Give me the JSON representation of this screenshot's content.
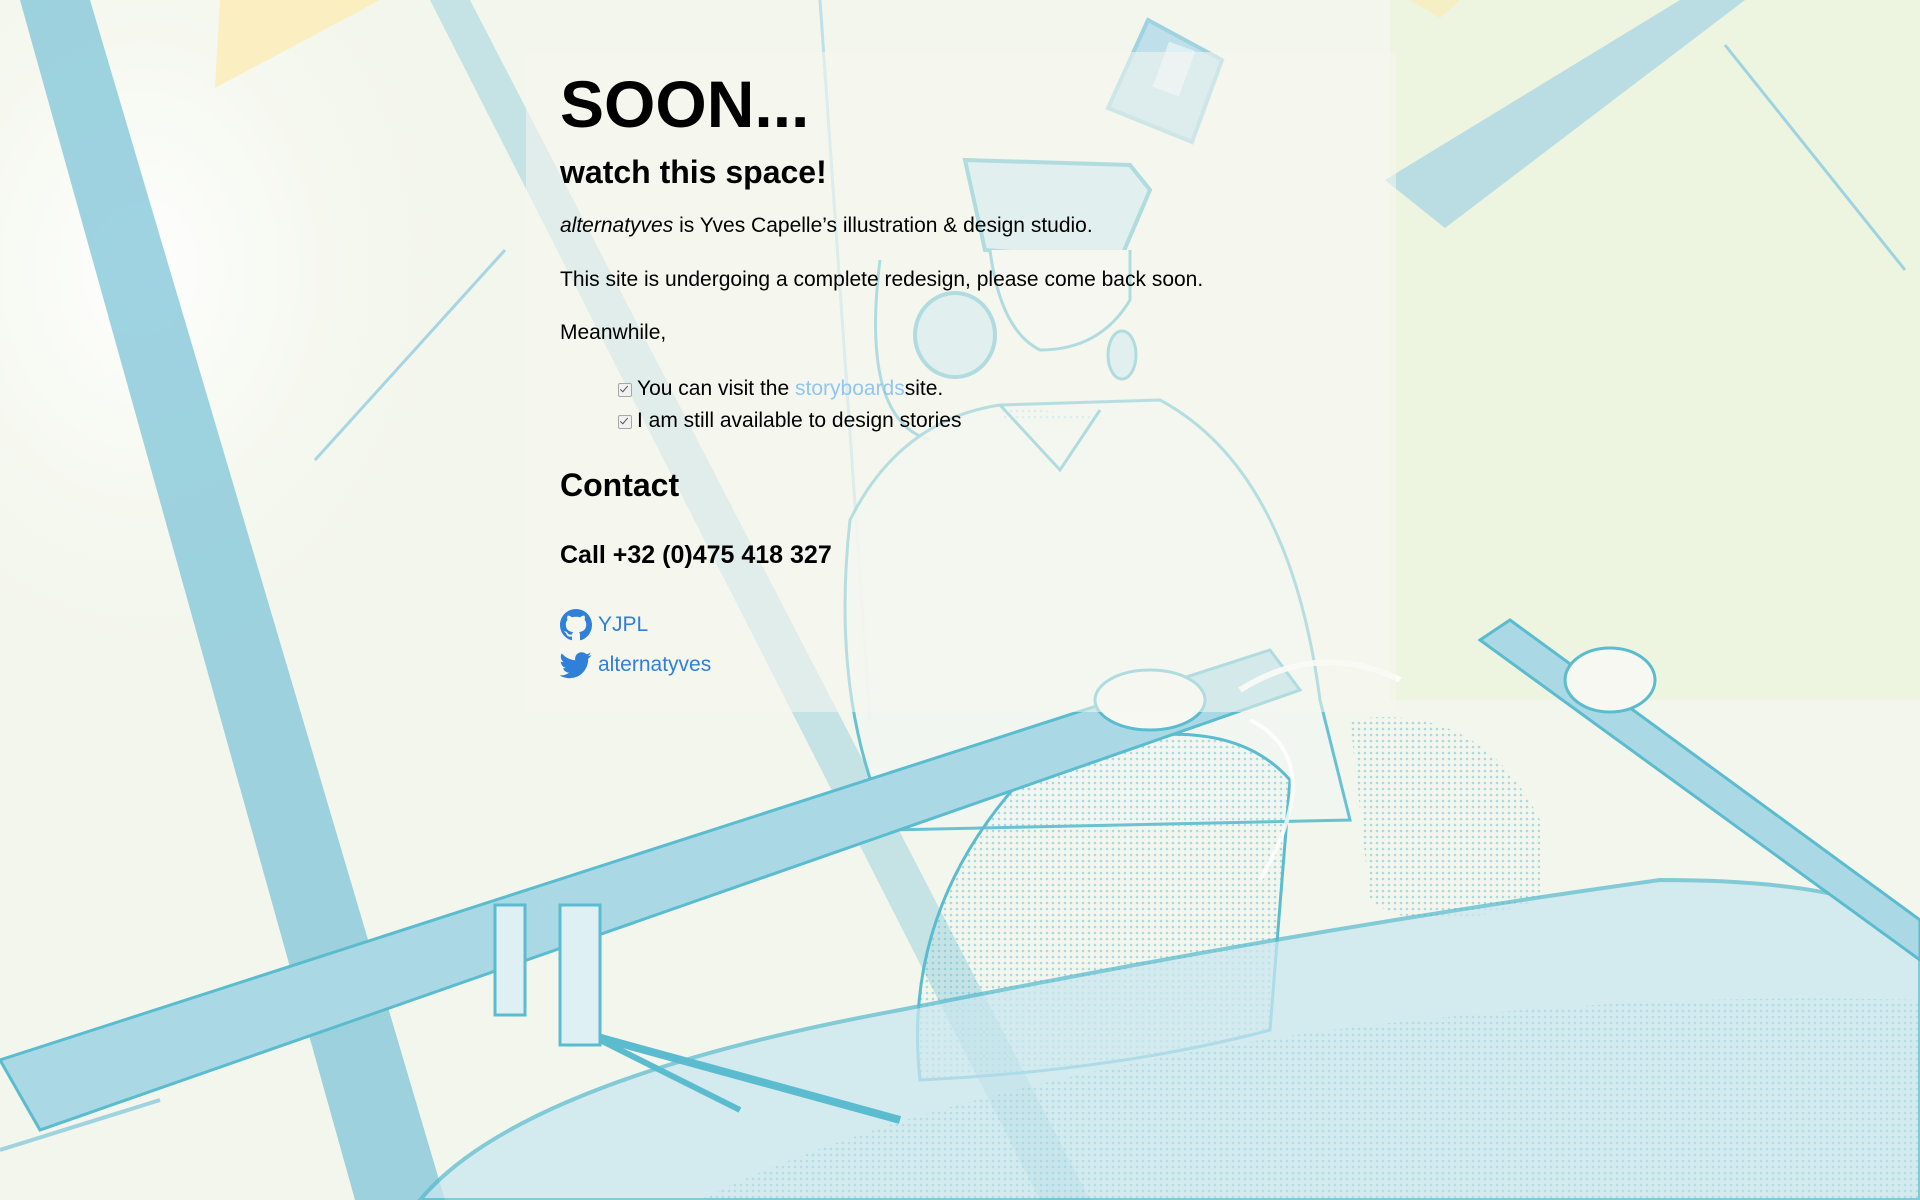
{
  "page": {
    "title": "SOON...",
    "subtitle": "watch this space!"
  },
  "intro": {
    "brand": "alternatyves",
    "text": " is Yves Capelle’s illustration & design studio."
  },
  "notice": "This site is undergoing a complete redesign, please come back soon.",
  "meanwhile": "Meanwhile,",
  "list": {
    "item1_before": "You can visit the ",
    "item1_link": "storyboards",
    "item1_after": " site.",
    "item2": "I am still available to design stories"
  },
  "contact": {
    "heading": "Contact",
    "call": "Call +32 (0)475 418 327"
  },
  "social": {
    "github_label": "YJPL",
    "github_icon": "github-icon",
    "twitter_label": "alternatyves",
    "twitter_icon": "twitter-icon"
  },
  "colors": {
    "light_link": "#90c6f2",
    "social_link": "#2f80d8",
    "illustration": "#5bbccf"
  }
}
